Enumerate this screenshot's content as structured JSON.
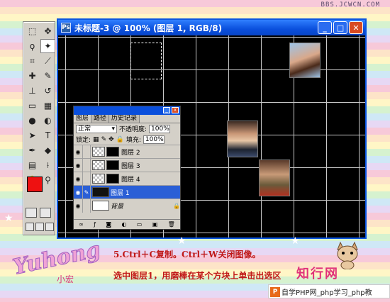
{
  "watermark": "BBS.JCWCN.COM",
  "toolbox": {
    "tools": [
      "marquee-icon",
      "move-icon",
      "lasso-icon",
      "magic-wand-icon",
      "crop-icon",
      "slice-icon",
      "healing-icon",
      "brush-icon",
      "stamp-icon",
      "history-brush-icon",
      "eraser-icon",
      "gradient-icon",
      "blur-icon",
      "dodge-icon",
      "path-select-icon",
      "type-icon",
      "pen-icon",
      "shape-icon",
      "notes-icon",
      "eyedropper-icon",
      "hand-icon",
      "zoom-icon"
    ],
    "foreground_color": "#ee1111",
    "background_color": "#707070"
  },
  "document": {
    "title": "未标题-3 @ 100% (图层 1, RGB/8)",
    "buttons": {
      "minimize": "_",
      "maximize": "□",
      "close": "✕"
    }
  },
  "layers_panel": {
    "tabs": [
      "图层",
      "路径",
      "历史记录"
    ],
    "blend_mode": "正常",
    "opacity_label": "不透明度:",
    "opacity_value": "100%",
    "lock_label": "锁定:",
    "fill_label": "填充:",
    "fill_value": "100%",
    "layers": [
      {
        "name": "图层 2",
        "visible": true,
        "selected": false
      },
      {
        "name": "图层 3",
        "visible": true,
        "selected": false
      },
      {
        "name": "图层 4",
        "visible": true,
        "selected": false
      },
      {
        "name": "图层 1",
        "visible": true,
        "selected": true
      },
      {
        "name": "背景",
        "visible": true,
        "selected": false,
        "locked": true
      }
    ]
  },
  "caption": {
    "line1": "5.Ctrl＋C复制。Ctrl＋W关闭图像。",
    "line2": "选中图层1，用磨棒在某个方块上单击出选区"
  },
  "branding": {
    "script_logo": "Yuhong",
    "script_sub": "小宏",
    "site": "知行网",
    "php_bar": "自学PHP网_php学习_php教"
  }
}
